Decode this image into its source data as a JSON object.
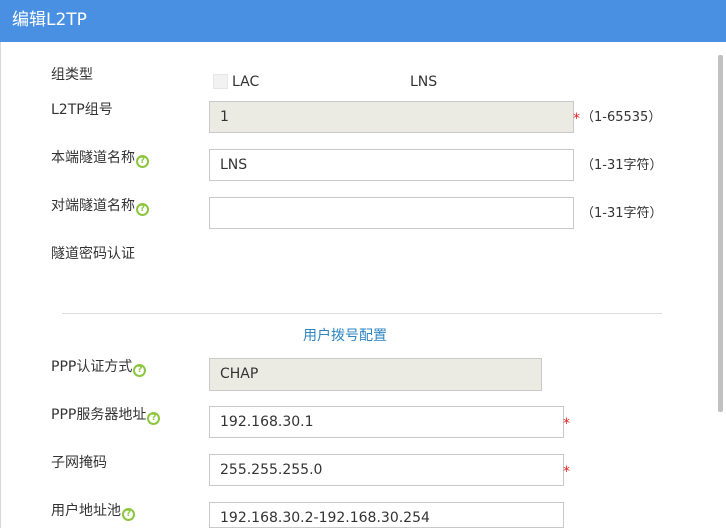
{
  "window": {
    "title": "编辑L2TP"
  },
  "form": {
    "group_type": {
      "label": "组类型",
      "options": [
        "LAC",
        "LNS"
      ]
    },
    "group_number": {
      "label": "L2TP组号",
      "value": "1",
      "required": "*",
      "hint": "（1-65535）"
    },
    "local_tunnel_name": {
      "label": "本端隧道名称",
      "value": "LNS",
      "hint": "（1-31字符）"
    },
    "remote_tunnel_name": {
      "label": "对端隧道名称",
      "value": "",
      "hint": "（1-31字符）"
    },
    "tunnel_password_auth": {
      "label": "隧道密码认证"
    }
  },
  "dialup": {
    "section_title": "用户拨号配置",
    "ppp_auth": {
      "label": "PPP认证方式",
      "value": "CHAP"
    },
    "ppp_server_addr": {
      "label": "PPP服务器地址",
      "value": "192.168.30.1",
      "required": "*"
    },
    "subnet_mask": {
      "label": "子网掩码",
      "value": "255.255.255.0",
      "required": "*"
    },
    "user_pool": {
      "label": "用户地址池",
      "value": "192.168.30.2-192.168.30.254"
    }
  },
  "icons": {
    "help": "?"
  },
  "colors": {
    "titlebar": "#4a90e2",
    "accent": "#2e86c1",
    "help_icon": "#8cc63f",
    "required": "#e02020"
  }
}
